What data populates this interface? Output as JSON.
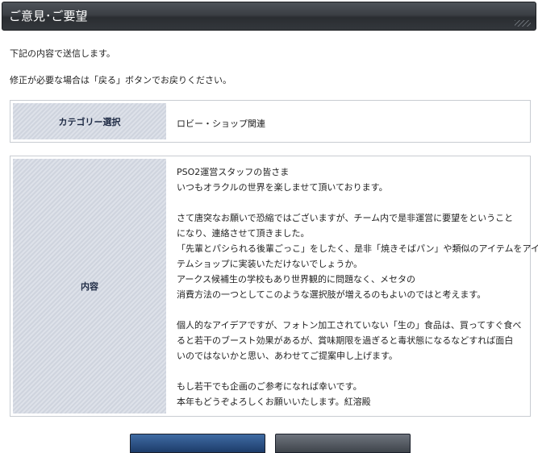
{
  "header": {
    "title": "ご意見･ご要望"
  },
  "intro": {
    "line1": "下記の内容で送信します。",
    "line2": "修正が必要な場合は「戻る」ボタンでお戻りください。"
  },
  "category": {
    "label": "カテゴリー選択",
    "value": "ロビー・ショップ関連"
  },
  "content": {
    "label": "内容",
    "lines": [
      "PSO2運営スタッフの皆さま",
      "いつもオラクルの世界を楽しませて頂いております。",
      "",
      "さて唐突なお願いで恐縮ではございますが、チーム内で是非運営に要望をということ",
      "になり、連絡させて頂きました。",
      "「先輩とパシられる後輩ごっこ」をしたく、是非「焼きそばパン」や類似のアイテムをアイ",
      "テムショップに実装いただけないでしょうか。",
      "アークス候補生の学校もあり世界観的に問題なく、メセタの",
      "消費方法の一つとしてこのような選択肢が増えるのもよいのではと考えます。",
      "",
      "個人的なアイデアですが、フォトン加工されていない「生の」食品は、買ってすぐ食べ",
      "ると若干のブースト効果があるが、賞味期限を過ぎると毒状態になるなどすれば面白",
      "いのではないかと思い、あわせてご提案申し上げます。",
      "",
      "もし若干でも企画のご参考になれば幸いです。",
      "本年もどうぞよろしくお願いいたします。紅溶殿"
    ]
  },
  "buttons": {}
}
